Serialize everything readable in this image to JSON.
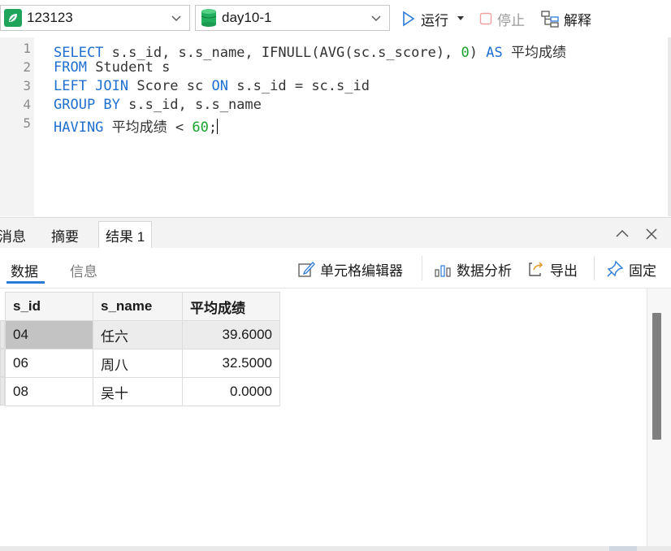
{
  "toolbar": {
    "connection": {
      "value": "123123",
      "icon": "connection-leaf-icon"
    },
    "database": {
      "value": "day10-1",
      "icon": "database-cylinder-icon"
    },
    "run_label": "运行",
    "stop_label": "停止",
    "explain_label": "解释"
  },
  "editor": {
    "line_numbers": [
      "1",
      "2",
      "3",
      "4",
      "5"
    ],
    "lines": [
      [
        {
          "t": "SELECT",
          "c": "kw"
        },
        {
          "t": " s.s_id, s.s_name, IFNULL(AVG(sc.s_score), ",
          "c": ""
        },
        {
          "t": "0",
          "c": "num"
        },
        {
          "t": ") ",
          "c": ""
        },
        {
          "t": "AS",
          "c": "kw"
        },
        {
          "t": " 平均成绩",
          "c": ""
        }
      ],
      [
        {
          "t": "FROM",
          "c": "kw"
        },
        {
          "t": " Student s",
          "c": ""
        }
      ],
      [
        {
          "t": "LEFT JOIN",
          "c": "kw"
        },
        {
          "t": " Score sc ",
          "c": ""
        },
        {
          "t": "ON",
          "c": "kw"
        },
        {
          "t": " s.s_id = sc.s_id",
          "c": ""
        }
      ],
      [
        {
          "t": "GROUP BY",
          "c": "kw"
        },
        {
          "t": " s.s_id, s.s_name",
          "c": ""
        }
      ],
      [
        {
          "t": "HAVING",
          "c": "kw"
        },
        {
          "t": " 平均成绩 < ",
          "c": ""
        },
        {
          "t": "60",
          "c": "num"
        },
        {
          "t": ";",
          "c": ""
        }
      ]
    ]
  },
  "panel_tabs": {
    "messages": "消息",
    "summary": "摘要",
    "result": "结果 1"
  },
  "subbar": {
    "data_tab": "数据",
    "info_tab": "信息",
    "cell_editor": "单元格编辑器",
    "data_analysis": "数据分析",
    "export": "导出",
    "pin": "固定"
  },
  "grid": {
    "columns": [
      "s_id",
      "s_name",
      "平均成绩"
    ],
    "rows": [
      [
        "04",
        "任六",
        "39.6000"
      ],
      [
        "06",
        "周八",
        "32.5000"
      ],
      [
        "08",
        "吴十",
        "0.0000"
      ]
    ]
  },
  "colors": {
    "keyword": "#1f6fd1",
    "number": "#1aa12a",
    "accent": "#2a7bd8",
    "run_green": "#1fa55b"
  }
}
